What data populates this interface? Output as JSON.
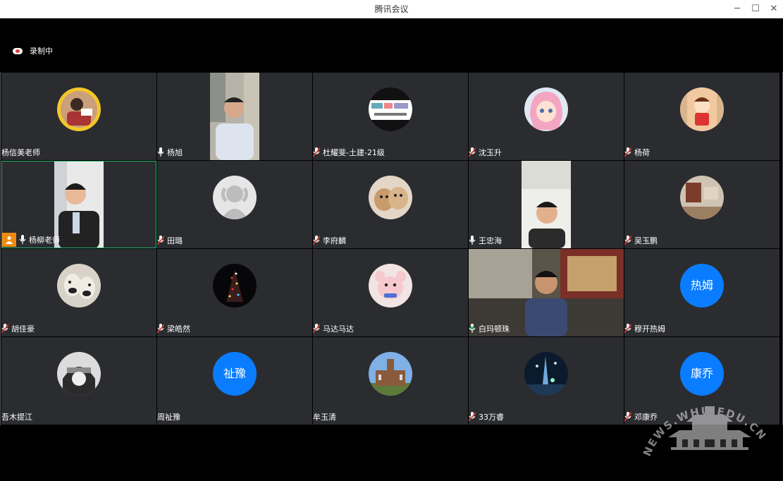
{
  "window": {
    "title": "腾讯会议"
  },
  "recording": {
    "label": "录制中"
  },
  "watermark": {
    "text": "NEWS.WHU.EDU.CN"
  },
  "participants": [
    {
      "name": "杨信美老师"
    },
    {
      "name": "杨旭"
    },
    {
      "name": "杜耀斐-土建-21级"
    },
    {
      "name": "沈玉升"
    },
    {
      "name": "杨荷"
    },
    {
      "name": "杨柳老师"
    },
    {
      "name": "田璐"
    },
    {
      "name": "李府麟"
    },
    {
      "name": "王忠海"
    },
    {
      "name": "吴玉鹏"
    },
    {
      "name": "胡佳豪"
    },
    {
      "name": "梁皓然"
    },
    {
      "name": "马达马达"
    },
    {
      "name": "白玛顿珠"
    },
    {
      "name": "穆开热姆"
    },
    {
      "name": "吾木提江"
    },
    {
      "name": "周祉豫"
    },
    {
      "name": "牟玉清"
    },
    {
      "name": "33万睿"
    },
    {
      "name": "邓康乔"
    }
  ],
  "avatar_text": {
    "p14": "热姆",
    "p16": "祉豫",
    "p19": "康乔"
  },
  "colors": {
    "tile": "#2b2c30",
    "avatar_blue": "#0a7cff",
    "active_border": "#22b36b",
    "host_badge": "#f08a10"
  }
}
